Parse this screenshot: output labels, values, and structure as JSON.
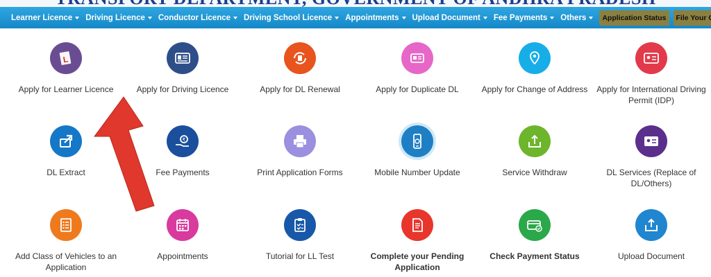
{
  "banner": {
    "title": "TRANSPORT DEPARTMENT, GOVERNMENT OF ANDHRA PRADESH"
  },
  "nav": {
    "items": [
      {
        "label": "Learner Licence",
        "dropdown": true
      },
      {
        "label": "Driving Licence",
        "dropdown": true
      },
      {
        "label": "Conductor Licence",
        "dropdown": true
      },
      {
        "label": "Driving School Licence",
        "dropdown": true
      },
      {
        "label": "Appointments",
        "dropdown": true
      },
      {
        "label": "Upload Document",
        "dropdown": true
      },
      {
        "label": "Fee Payments",
        "dropdown": true
      },
      {
        "label": "Others",
        "dropdown": true
      }
    ],
    "buttons": [
      {
        "label": "Application Status"
      },
      {
        "label": "File Your Grievance"
      }
    ]
  },
  "services": [
    {
      "label": "Apply for Learner Licence",
      "icon": "learner-l-icon",
      "color": "#6a4c93"
    },
    {
      "label": "Apply for Driving Licence",
      "icon": "id-card-icon",
      "color": "#2e4e8a"
    },
    {
      "label": "Apply for DL Renewal",
      "icon": "renewal-icon",
      "color": "#e8541e"
    },
    {
      "label": "Apply for Duplicate DL",
      "icon": "duplicate-card-icon",
      "color": "#e667c8"
    },
    {
      "label": "Apply for Change of Address",
      "icon": "location-pin-icon",
      "color": "#17aee8"
    },
    {
      "label": "Apply for International Driving Permit (IDP)",
      "icon": "permit-card-icon",
      "color": "#e23a4b"
    },
    {
      "label": "DL Extract",
      "icon": "share-arrow-icon",
      "color": "#1577c7"
    },
    {
      "label": "Fee Payments",
      "icon": "payment-hand-icon",
      "color": "#1b4f9e"
    },
    {
      "label": "Print Application Forms",
      "icon": "printer-icon",
      "color": "#9b8fe0"
    },
    {
      "label": "Mobile Number Update",
      "icon": "mobile-phone-icon",
      "color": "#1f7fc4"
    },
    {
      "label": "Service Withdraw",
      "icon": "upload-tray-icon",
      "color": "#6db52a"
    },
    {
      "label": "DL Services (Replace of DL/Others)",
      "icon": "license-card-icon",
      "color": "#5b2f8c"
    },
    {
      "label": "Add Class of Vehicles to an Application",
      "icon": "checklist-icon",
      "color": "#ef7a1e"
    },
    {
      "label": "Appointments",
      "icon": "calendar-icon",
      "color": "#d93a9e"
    },
    {
      "label": "Tutorial for LL Test",
      "icon": "clipboard-icon",
      "color": "#1858a8"
    },
    {
      "label": "Complete your Pending Application",
      "icon": "document-icon",
      "color": "#e8362d",
      "bold": true
    },
    {
      "label": "Check Payment Status",
      "icon": "payment-card-icon",
      "color": "#2aa84a",
      "bold": true
    },
    {
      "label": "Upload Document",
      "icon": "upload-box-icon",
      "color": "#1f86cf"
    }
  ],
  "annotation": {
    "color": "#e0382c"
  }
}
